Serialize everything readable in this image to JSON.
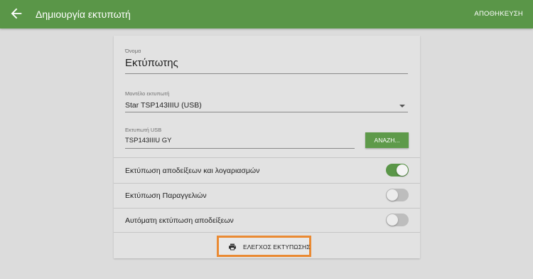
{
  "appbar": {
    "title": "Δημιουργία εκτυπωτή",
    "action_label": "ΑΠΟΘΗΚΕΥΣΗ",
    "back_icon": "arrow-left-icon",
    "color": "#5a9648"
  },
  "form": {
    "name": {
      "label": "Όνομα",
      "value": "Εκτύπωτης"
    },
    "model": {
      "label": "Μοντέλο εκτυπωτή",
      "value": "Star TSP143IIIU (USB)"
    },
    "usb": {
      "label": "Εκτυπωτή USB",
      "value": "TSP143IIIU GY",
      "search_label": "ΑΝΑΖΗ..."
    }
  },
  "toggles": [
    {
      "label": "Εκτύπωση αποδείξεων και λογαριασμών",
      "on": true
    },
    {
      "label": "Εκτύπωση Παραγγελιών",
      "on": false
    },
    {
      "label": "Αυτόματη εκτύπωση αποδείξεων",
      "on": false
    }
  ],
  "test_print": {
    "label": "ΕΛΕΓΧΟΣ ΕΚΤΥΠΩΣΗΣ",
    "icon": "printer-icon",
    "highlight_color": "#ea8a33"
  }
}
